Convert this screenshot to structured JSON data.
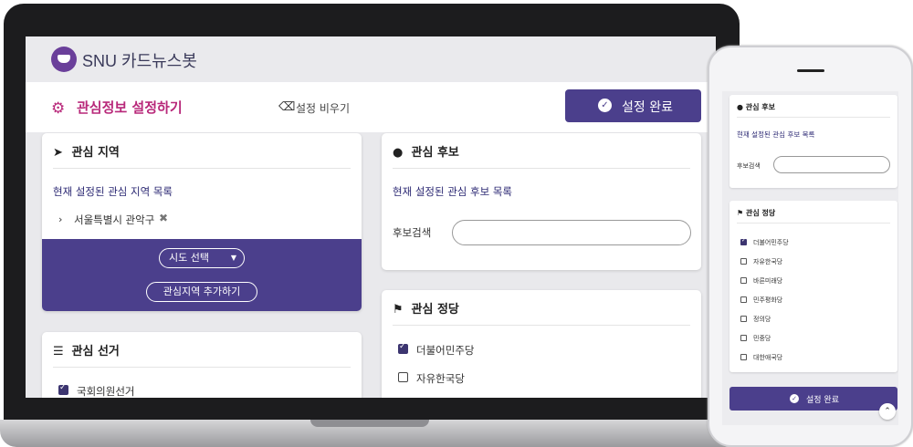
{
  "app": {
    "brand": "SNU 카드뉴스봇"
  },
  "toolbar": {
    "title": "관심정보 설정하기",
    "clear_label": "설정 비우기",
    "done_label": "설정 완료"
  },
  "region_card": {
    "title": "관심 지역",
    "subtitle": "현재 설정된 관심 지역 목록",
    "items": [
      "서울특별시 관악구"
    ],
    "sido_select": "시도 선택",
    "add_button": "관심지역 추가하기"
  },
  "candidate_card": {
    "title": "관심 후보",
    "subtitle": "현재 설정된 관심 후보 목록",
    "search_label": "후보검색",
    "search_value": ""
  },
  "election_card": {
    "title": "관심 선거",
    "items": [
      {
        "label": "국회의원선거",
        "checked": true
      }
    ]
  },
  "party_card": {
    "title": "관심 정당",
    "items": [
      {
        "label": "더불어민주당",
        "checked": true
      },
      {
        "label": "자유한국당",
        "checked": false
      }
    ]
  },
  "mobile": {
    "candidate_title": "관심 후보",
    "candidate_subtitle": "현재 설정된 관심 후보 목록",
    "search_label": "후보검색",
    "party_title": "관심 정당",
    "parties": [
      {
        "label": "더불어민주당",
        "checked": true
      },
      {
        "label": "자유한국당",
        "checked": false
      },
      {
        "label": "바른미래당",
        "checked": false
      },
      {
        "label": "민주평화당",
        "checked": false
      },
      {
        "label": "정의당",
        "checked": false
      },
      {
        "label": "민중당",
        "checked": false
      },
      {
        "label": "대한애국당",
        "checked": false
      }
    ],
    "done_label": "설정 완료"
  }
}
